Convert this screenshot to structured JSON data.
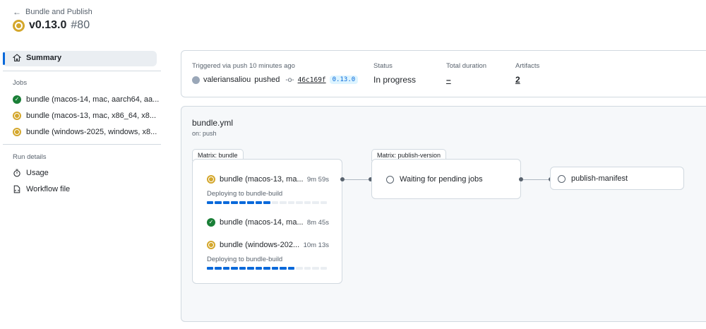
{
  "header": {
    "back_label": "Bundle and Publish",
    "version": "v0.13.0",
    "run_number": "#80"
  },
  "sidebar": {
    "summary_label": "Summary",
    "jobs_heading": "Jobs",
    "jobs": [
      {
        "label": "bundle (macos-14, mac, aarch64, aa...",
        "status": "success"
      },
      {
        "label": "bundle (macos-13, mac, x86_64, x8...",
        "status": "in_progress"
      },
      {
        "label": "bundle (windows-2025, windows, x8...",
        "status": "in_progress"
      }
    ],
    "run_details_heading": "Run details",
    "usage_label": "Usage",
    "workflow_file_label": "Workflow file"
  },
  "summary": {
    "trigger_label": "Triggered via push 10 minutes ago",
    "actor": "valeriansaliou",
    "action": "pushed",
    "commit": "46c169f",
    "tag": "0.13.0",
    "status_label": "Status",
    "status_value": "In progress",
    "duration_label": "Total duration",
    "duration_value": "–",
    "artifacts_label": "Artifacts",
    "artifacts_value": "2"
  },
  "workflow": {
    "file": "bundle.yml",
    "trigger": "on: push",
    "matrix_bundle": {
      "tab_label": "Matrix: bundle",
      "jobs": [
        {
          "name": "bundle (macos-13, ma...",
          "duration": "9m 59s",
          "status": "in_progress",
          "step": "Deploying to bundle-build",
          "progress": 0.55
        },
        {
          "name": "bundle (macos-14, ma...",
          "duration": "8m 45s",
          "status": "success"
        },
        {
          "name": "bundle (windows-202...",
          "duration": "10m 13s",
          "status": "in_progress",
          "step": "Deploying to bundle-build",
          "progress": 0.73
        }
      ]
    },
    "matrix_publish": {
      "tab_label": "Matrix: publish-version",
      "job": "Waiting for pending jobs"
    },
    "publish_manifest": {
      "job": "publish-manifest"
    }
  },
  "colors": {
    "accent": "#0969da",
    "in_progress": "#d4a72c",
    "success": "#1a7f37"
  }
}
